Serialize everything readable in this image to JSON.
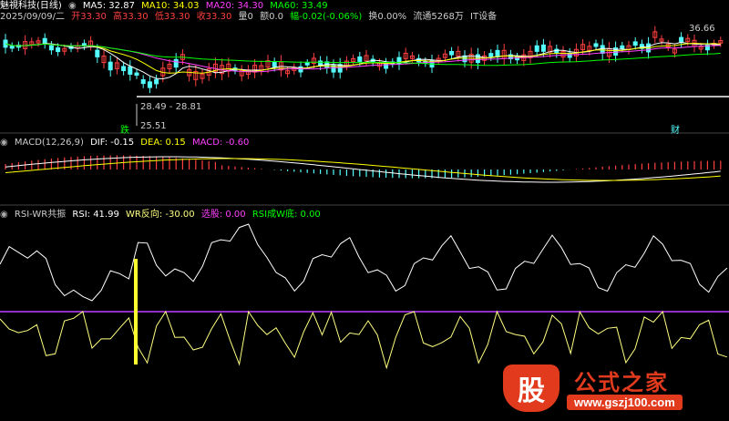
{
  "header": {
    "stock_name": "魅視科技(日线)",
    "ma5": "MA5: 32.87",
    "ma10": "MA10: 34.03",
    "ma20": "MA20: 34.30",
    "ma60": "MA60: 33.49",
    "date": "2025/09/09/二",
    "open": "开33.30",
    "high": "高33.30",
    "low": "低33.30",
    "close": "收33.30",
    "volume": "量0",
    "amount": "额0.0",
    "change": "幅-0.02(-0.06%)",
    "turnover": "换0.00%",
    "float": "流通5268万",
    "sector": "IT设备"
  },
  "price_labels": {
    "high_label": "36.66",
    "range_label": "28.49 - 28.81",
    "low_label": "25.51",
    "mark_a": "跌",
    "mark_b": "财"
  },
  "macd": {
    "title": "MACD(12,26,9)",
    "dif": "DIF: -0.15",
    "dea": "DEA: 0.15",
    "macd": "MACD: -0.60"
  },
  "rsiwr": {
    "title": "RSI-WR共振",
    "rsi": "RSI: 41.99",
    "wr": "WR反向: -30.00",
    "pick": "选股: 0.00",
    "rsiw": "RSI成W底: 0.00"
  },
  "watermark": {
    "badge": "股",
    "title": "公式之家",
    "url": "www.gszj100.com"
  },
  "colors": {
    "up": "#ff4040",
    "down": "#54ffff",
    "ma5": "#ffffff",
    "ma10": "#ffff00",
    "ma20": "#ff40ff",
    "ma60": "#00ff00",
    "rsi": "#ffffff",
    "wr": "#ffff80",
    "midline": "#c040ff",
    "signal": "#ffff30"
  }
}
